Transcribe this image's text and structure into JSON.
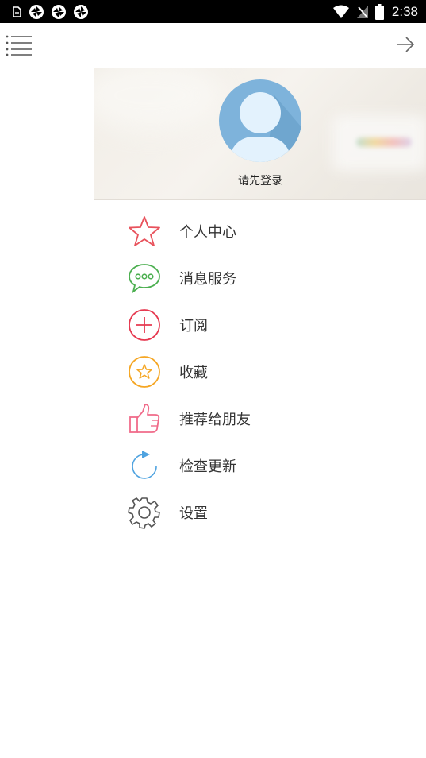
{
  "status_bar": {
    "time": "2:38"
  },
  "profile": {
    "login_prompt": "请先登录"
  },
  "menu": {
    "items": [
      {
        "label": "个人中心",
        "icon": "star-outline-icon",
        "color": "#e8525c"
      },
      {
        "label": "消息服务",
        "icon": "chat-bubble-icon",
        "color": "#4caf50"
      },
      {
        "label": "订阅",
        "icon": "plus-circle-icon",
        "color": "#e63950"
      },
      {
        "label": "收藏",
        "icon": "star-circle-icon",
        "color": "#f5a623"
      },
      {
        "label": "推荐给朋友",
        "icon": "thumbs-up-icon",
        "color": "#f06b8a"
      },
      {
        "label": "检查更新",
        "icon": "refresh-icon",
        "color": "#4fa3e0"
      },
      {
        "label": "设置",
        "icon": "gear-icon",
        "color": "#555555"
      }
    ]
  },
  "colors": {
    "text": "#333333",
    "avatar_bg": "#7eb3db",
    "avatar_fg": "#e3f2fd"
  }
}
